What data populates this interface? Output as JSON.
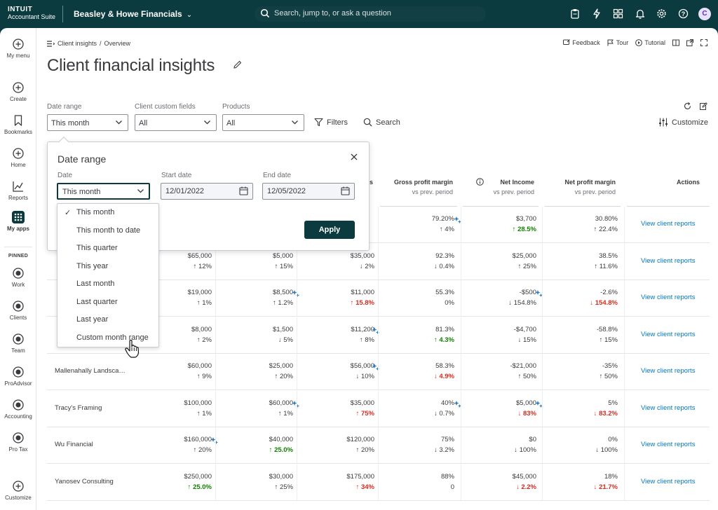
{
  "topbar": {
    "logo_line1": "INTUIT",
    "logo_line2": "Accountant Suite",
    "company": "Beasley & Howe Financials",
    "search_placeholder": "Search, jump to, or ask a question",
    "avatar_initial": "C"
  },
  "leftnav": {
    "items": [
      {
        "label": "My menu"
      },
      {
        "label": "Create"
      },
      {
        "label": "Bookmarks"
      },
      {
        "label": "Home"
      },
      {
        "label": "Reports"
      },
      {
        "label": "My apps"
      }
    ],
    "pinned_label": "PINNED",
    "pinned": [
      {
        "label": "Work"
      },
      {
        "label": "Clients"
      },
      {
        "label": "Team"
      },
      {
        "label": "ProAdvisor"
      },
      {
        "label": "Accounting"
      },
      {
        "label": "Pro Tax"
      }
    ],
    "customize_label": "Customize"
  },
  "header": {
    "breadcrumb_parent": "Client insights",
    "breadcrumb_sep": "/",
    "breadcrumb_current": "Overview",
    "title": "Client financial insights",
    "feedback": "Feedback",
    "tour": "Tour",
    "tutorial": "Tutorial"
  },
  "filters": {
    "date_range_label": "Date range",
    "date_range_value": "This month",
    "custom_fields_label": "Client custom fields",
    "custom_fields_value": "All",
    "products_label": "Products",
    "products_value": "All",
    "filters_btn": "Filters",
    "search_btn": "Search",
    "customize_btn": "Customize"
  },
  "columns": {
    "gpm": "Gross profit margin",
    "ni": "Net Income",
    "npm": "Net profit margin",
    "actions": "Actions",
    "vs": "vs prev. period",
    "partial_s": "s"
  },
  "rows": [
    {
      "name": "",
      "c1": "",
      "c1d": "",
      "c2": "",
      "c2d": "",
      "c3": "",
      "c3d": "",
      "c4": "79.20%",
      "c4d": "4%",
      "c5": "$3,700",
      "c5d": "28.5%",
      "c6": "30.80%",
      "c6d": "22.4%",
      "action": "View client reports"
    },
    {
      "name": "",
      "c1": "$65,000",
      "c1d": "12%",
      "c2": "$5,000",
      "c2d": "15%",
      "c3": "$35,000",
      "c3d": "2%",
      "c4": "92.3%",
      "c4d": "0.4%",
      "c5": "$25,000",
      "c5d": "25%",
      "c6": "38.5%",
      "c6d": "11.6%",
      "action": "View client reports"
    },
    {
      "name": "",
      "c1": "$19,000",
      "c1d": "1%",
      "c2": "$8,500",
      "c2d": "1.2%",
      "c3": "$11,000",
      "c3d": "15.8%",
      "c4": "55.3%",
      "c4d": "0%",
      "c5": "-$500",
      "c5d": "154.8%",
      "c6": "-2.6%",
      "c6d": "154.8%",
      "action": "View client reports"
    },
    {
      "name": "",
      "c1": "$8,000",
      "c1d": "2%",
      "c2": "$1,500",
      "c2d": "5%",
      "c3": "$11,200",
      "c3d": "8%",
      "c4": "81.3%",
      "c4d": "4.3%",
      "c5": "-$4,700",
      "c5d": "15%",
      "c6": "-58.8%",
      "c6d": "15%",
      "action": "View client reports"
    },
    {
      "name": "Mallenahally Landsca…",
      "c1": "$60,000",
      "c1d": "9%",
      "c2": "$25,000",
      "c2d": "20%",
      "c3": "$56,000",
      "c3d": "10%",
      "c4": "58.3%",
      "c4d": "4.9%",
      "c5": "-$21,000",
      "c5d": "50%",
      "c6": "-35%",
      "c6d": "50%",
      "action": "View client reports"
    },
    {
      "name": "Tracy's Framing",
      "c1": "$100,000",
      "c1d": "1%",
      "c2": "$60,000",
      "c2d": "1%",
      "c3": "$35,000",
      "c3d": "75%",
      "c4": "40%",
      "c4d": "0.7%",
      "c5": "$5,000",
      "c5d": "83%",
      "c6": "5%",
      "c6d": "83.2%",
      "action": "View client reports"
    },
    {
      "name": "Wu Financial",
      "c1": "$160,000",
      "c1d": "20%",
      "c2": "$40,000",
      "c2d": "25.0%",
      "c3": "$120,000",
      "c3d": "20%",
      "c4": "75%",
      "c4d": "3.2%",
      "c5": "$0",
      "c5d": "100%",
      "c6": "0%",
      "c6d": "100%",
      "action": "View client reports"
    },
    {
      "name": "Yanosev Consulting",
      "c1": "$250,000",
      "c1d": "25.0%",
      "c2": "$30,000",
      "c2d": "25%",
      "c3": "$175,000",
      "c3d": "34%",
      "c4": "88%",
      "c4d": "0",
      "c5": "$45,000",
      "c5d": "2.2%",
      "c6": "18%",
      "c6d": "21.7%",
      "action": "View client reports"
    }
  ],
  "popover": {
    "title": "Date range",
    "date_label": "Date",
    "date_value": "This month",
    "start_label": "Start date",
    "start_value": "12/01/2022",
    "end_label": "End date",
    "end_value": "12/05/2022",
    "apply": "Apply"
  },
  "dropdown": {
    "check": "✓",
    "options": [
      "This month",
      "This month to date",
      "This quarter",
      "This year",
      "Last month",
      "Last quarter",
      "Last year",
      "Custom month range"
    ]
  },
  "colors": {
    "brand": "#0b3b3f",
    "link": "#0077c5",
    "good": "#108000",
    "bad": "#d52b1e"
  }
}
